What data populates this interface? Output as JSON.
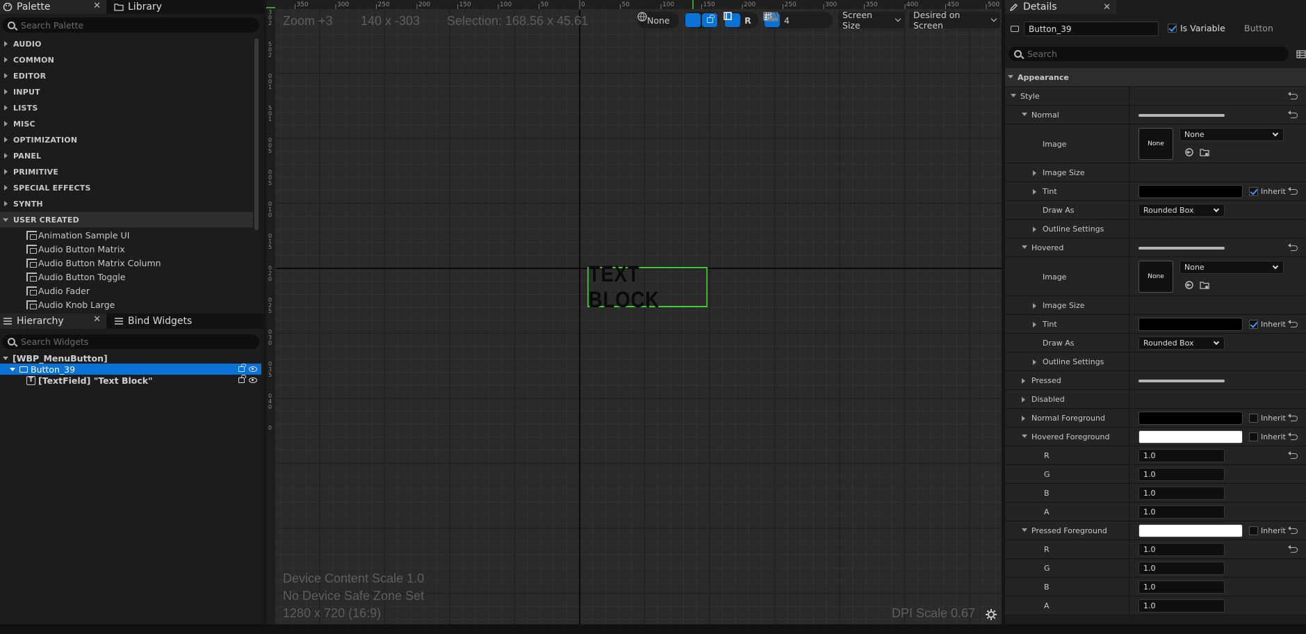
{
  "palette": {
    "tab_palette": "Palette",
    "tab_library": "Library",
    "search_placeholder": "Search Palette",
    "categories": [
      "AUDIO",
      "COMMON",
      "EDITOR",
      "INPUT",
      "LISTS",
      "MISC",
      "OPTIMIZATION",
      "PANEL",
      "PRIMITIVE",
      "SPECIAL EFFECTS",
      "SYNTH",
      "USER CREATED"
    ],
    "user_items": [
      "Animation Sample UI",
      "Audio Button Matrix",
      "Audio Button Matrix Column",
      "Audio Button Toggle",
      "Audio Fader",
      "Audio Knob Large"
    ]
  },
  "hierarchy": {
    "tab_hierarchy": "Hierarchy",
    "tab_bind": "Bind Widgets",
    "search_placeholder": "Search Widgets",
    "root": "[WBP_MenuButton]",
    "button": "Button_39",
    "textfield": "[TextField] \"Text Block\""
  },
  "viewport": {
    "zoom": "Zoom +3",
    "coords": "140 x -303",
    "selection": "Selection: 168.56 x 45.61",
    "locale_label": "None",
    "grid_snap": "4",
    "r_label": "R",
    "screen_size": "Screen Size",
    "desired": "Desired on Screen",
    "textblock": "TEXT BLOCK",
    "device_scale": "Device Content Scale 1.0",
    "safe_zone": "No Device Safe Zone Set",
    "resolution": "1280 x 720 (16:9)",
    "dpi": "DPI Scale 0.67",
    "ruler_top": [
      "350",
      "300",
      "250",
      "200",
      "150",
      "100",
      "50",
      "0",
      "50",
      "100",
      "150",
      "200",
      "250",
      "300",
      "350",
      "400",
      "450",
      "500"
    ],
    "ruler_left": [
      "3",
      "0",
      "2",
      "5",
      "0",
      "2",
      "0",
      "0",
      "1",
      "5",
      "0",
      "1",
      "0",
      "0",
      "5",
      "0",
      "0",
      "5",
      "0",
      "1",
      "0",
      "0",
      "1",
      "5",
      "0",
      "2",
      "0",
      "0",
      "2",
      "5",
      "0",
      "3",
      "0",
      "0",
      "3",
      "5",
      "0",
      "4",
      "0",
      "0"
    ]
  },
  "details": {
    "tab": "Details",
    "name_value": "Button_39",
    "is_variable": "Is Variable",
    "type": "Button",
    "search_placeholder": "Search",
    "appearance": "Appearance",
    "style": "Style",
    "normal": "Normal",
    "image": "Image",
    "none": "None",
    "image_size": "Image Size",
    "tint": "Tint",
    "inherit": "Inherit",
    "draw_as": "Draw As",
    "rounded_box": "Rounded Box",
    "outline": "Outline Settings",
    "hovered": "Hovered",
    "pressed": "Pressed",
    "disabled": "Disabled",
    "normal_fg": "Normal Foreground",
    "hovered_fg": "Hovered Foreground",
    "pressed_fg": "Pressed Foreground",
    "r": "R",
    "g": "G",
    "b": "B",
    "a": "A",
    "val": "1.0"
  },
  "colors": {
    "accent": "#0a72d6",
    "selection": "#3bd02e"
  }
}
